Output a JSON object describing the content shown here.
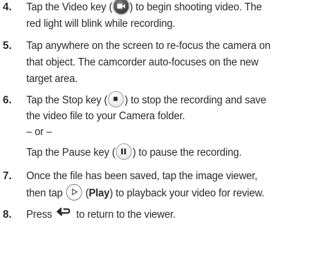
{
  "steps": [
    {
      "number": "4.",
      "line1_before": "Tap the Video key (",
      "line1_after": ") to begin shooting video. The",
      "line2": "red light will blink while recording."
    },
    {
      "number": "5.",
      "line1": "Tap anywhere on the screen to re-focus the camera on",
      "line2": "that object. The camcorder auto-focuses on the new",
      "line3": "target area."
    },
    {
      "number": "6.",
      "line1_before": "Tap the Stop key (",
      "line1_after": ") to stop the recording and save",
      "line2": "the video file to your Camera folder.",
      "or": "– or –",
      "alt_before": "Tap the Pause key (",
      "alt_after": ") to pause the recording."
    },
    {
      "number": "7.",
      "line1": "Once the file has been saved, tap the image viewer,",
      "line2_before": "then tap",
      "line2_play": "Play",
      "line2_after": "to playback your video for review."
    },
    {
      "number": "8.",
      "line1_before": "Press",
      "line1_after": "to return to the viewer."
    }
  ],
  "icons": {
    "video": "video-camera-icon",
    "stop": "stop-icon",
    "pause": "pause-icon",
    "play": "play-icon",
    "back": "back-arrow-icon"
  }
}
